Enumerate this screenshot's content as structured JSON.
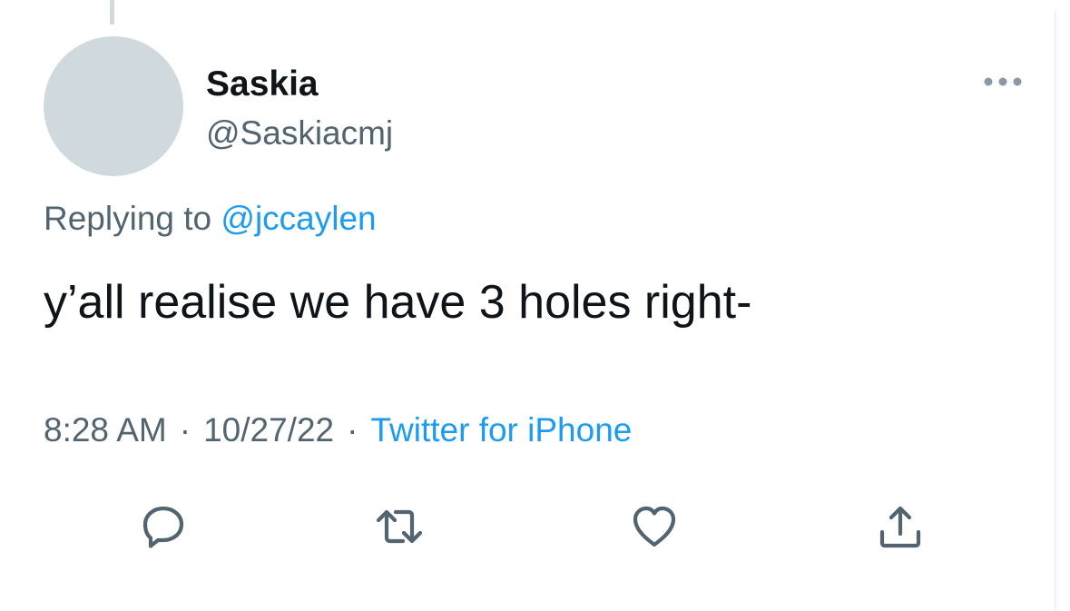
{
  "tweet": {
    "author": {
      "display_name": "Saskia",
      "handle": "@Saskiacmj"
    },
    "replying_to_prefix": "Replying to",
    "replying_to_handle": "@jccaylen",
    "text": "y’all realise we have 3 holes right-",
    "time": "8:28 AM",
    "separator": "·",
    "date": "10/27/22",
    "source": "Twitter for iPhone"
  },
  "actions": [
    {
      "icon": "reply-icon"
    },
    {
      "icon": "retweet-icon"
    },
    {
      "icon": "like-icon"
    },
    {
      "icon": "share-icon"
    }
  ],
  "colors": {
    "link": "#1d9bf0",
    "muted": "#536471",
    "text": "#0f1419",
    "avatar_placeholder": "#cfd9de"
  }
}
